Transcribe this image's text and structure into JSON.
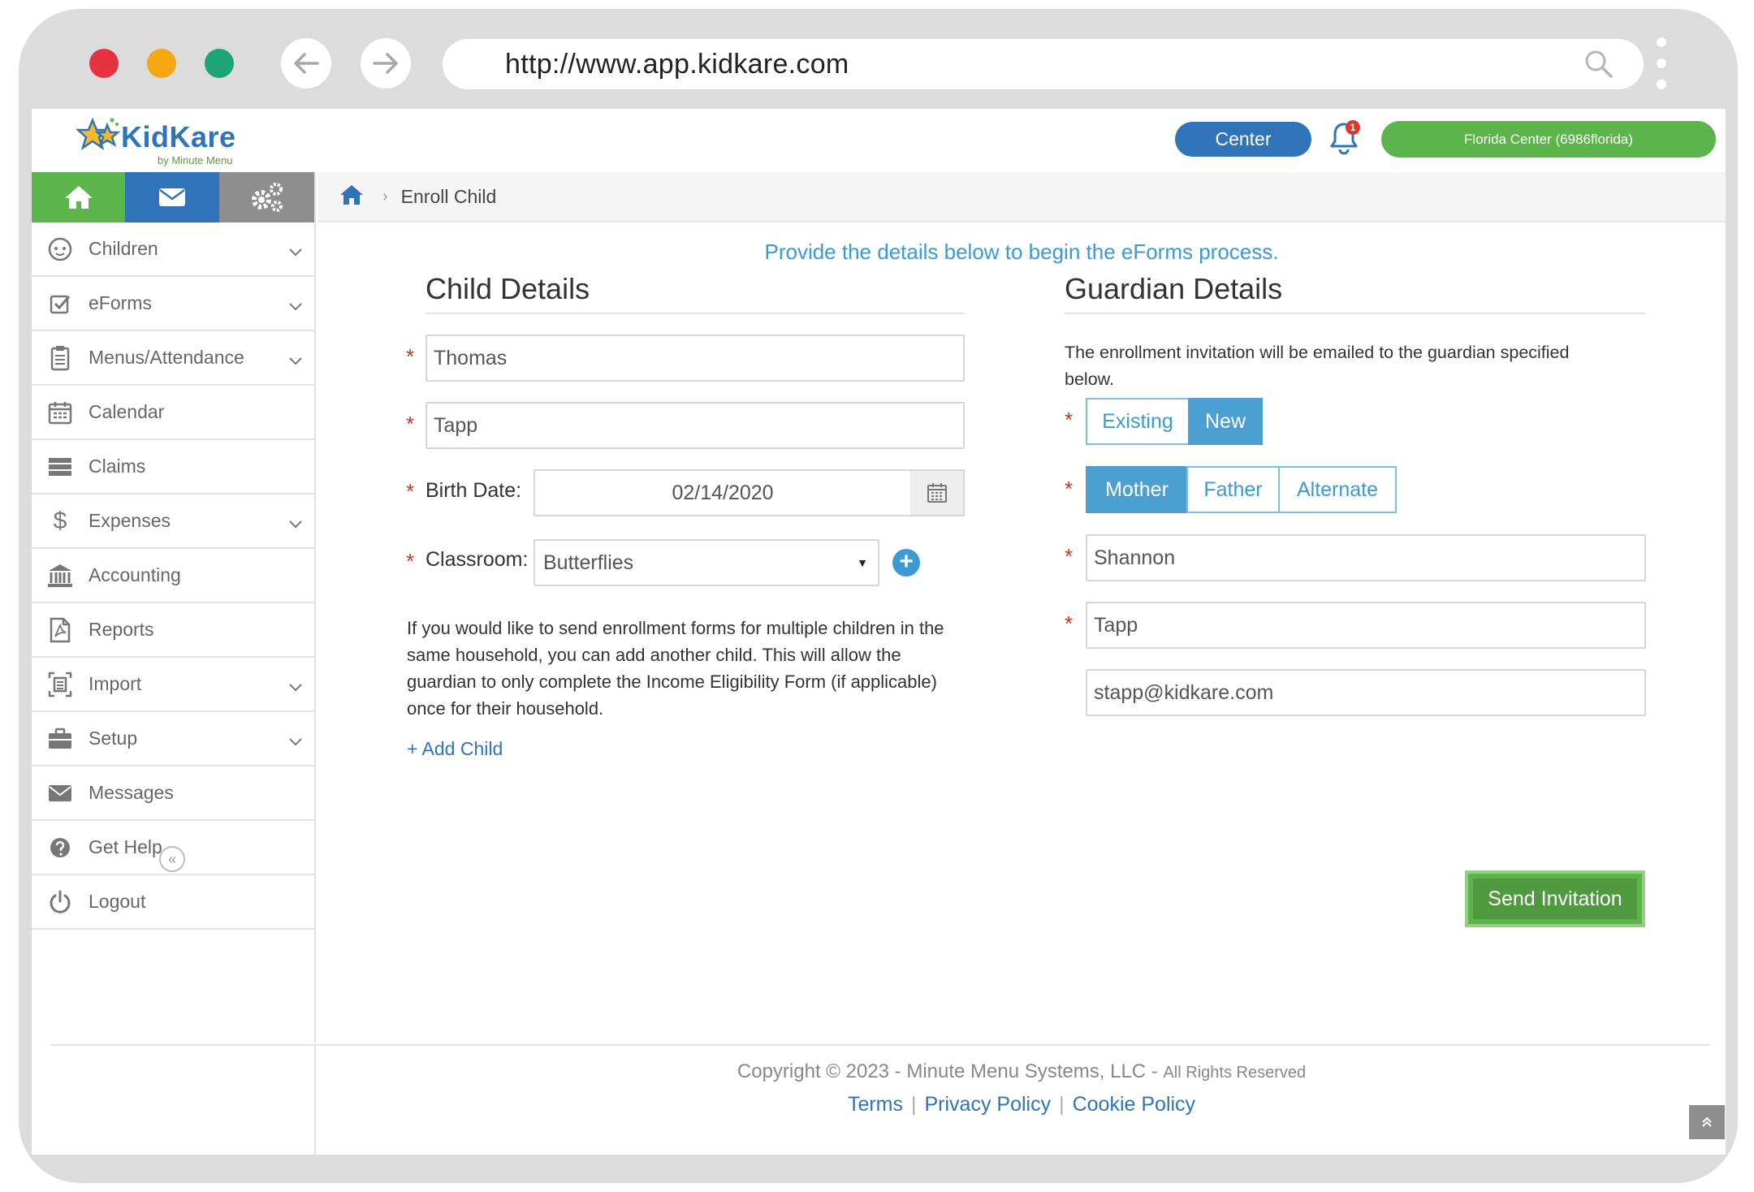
{
  "browser": {
    "url": "http://www.app.kidkare.com",
    "dot_colors": [
      "#e53341",
      "#f4a711",
      "#1ea577"
    ]
  },
  "header": {
    "logo_word": "KidKare",
    "logo_sub": "by Minute Menu",
    "center_label": "Center",
    "notification_count": "1",
    "account_label": "Florida Center (6986florida)"
  },
  "sidebar": {
    "items": [
      {
        "label": "Children",
        "icon": "child-face-icon",
        "has_chevron": true
      },
      {
        "label": "eForms",
        "icon": "checkbox-icon",
        "has_chevron": true
      },
      {
        "label": "Menus/Attendance",
        "icon": "clipboard-icon",
        "has_chevron": true
      },
      {
        "label": "Calendar",
        "icon": "calendar-icon",
        "has_chevron": false
      },
      {
        "label": "Claims",
        "icon": "claims-icon",
        "has_chevron": false
      },
      {
        "label": "Expenses",
        "icon": "dollar-icon",
        "has_chevron": true
      },
      {
        "label": "Accounting",
        "icon": "bank-icon",
        "has_chevron": false
      },
      {
        "label": "Reports",
        "icon": "pdf-icon",
        "has_chevron": false
      },
      {
        "label": "Import",
        "icon": "import-icon",
        "has_chevron": true
      },
      {
        "label": "Setup",
        "icon": "briefcase-icon",
        "has_chevron": true
      },
      {
        "label": "Messages",
        "icon": "envelope-icon",
        "has_chevron": false
      },
      {
        "label": "Get Help",
        "icon": "help-icon",
        "has_chevron": false
      },
      {
        "label": "Logout",
        "icon": "power-icon",
        "has_chevron": false
      }
    ]
  },
  "breadcrumb": {
    "current": "Enroll Child"
  },
  "page": {
    "intro": "Provide the details below to begin the eForms process.",
    "child": {
      "title": "Child Details",
      "first_name": "Thomas",
      "last_name": "Tapp",
      "birth_label": "Birth Date:",
      "birth_date": "02/14/2020",
      "classroom_label": "Classroom:",
      "classroom": "Butterflies",
      "note_lines": [
        "If you would like to send enrollment forms for multiple children in the",
        "same household, you can add another child. This will allow the",
        "guardian to only complete the Income Eligibility Form (if applicable)",
        "once for their household."
      ],
      "add_child": "+ Add Child"
    },
    "guardian": {
      "title": "Guardian Details",
      "desc_line1": "The enrollment invitation will be emailed to the guardian specified",
      "desc_line2": "below.",
      "mode_options": [
        "Existing",
        "New"
      ],
      "mode_selected": "New",
      "relation_options": [
        "Mother",
        "Father",
        "Alternate"
      ],
      "relation_selected": "Mother",
      "first_name": "Shannon",
      "last_name": "Tapp",
      "email": "stapp@kidkare.com",
      "send_label": "Send Invitation"
    }
  },
  "footer": {
    "copyright": "Copyright © 2023 - Minute Menu Systems, LLC -",
    "rights": "All Rights Reserved",
    "links": [
      "Terms",
      "Privacy Policy",
      "Cookie Policy"
    ]
  },
  "colors": {
    "green": "#5cb54a",
    "blue": "#2f73b8",
    "light_blue": "#3a9ad1",
    "required": "#c0392b"
  }
}
